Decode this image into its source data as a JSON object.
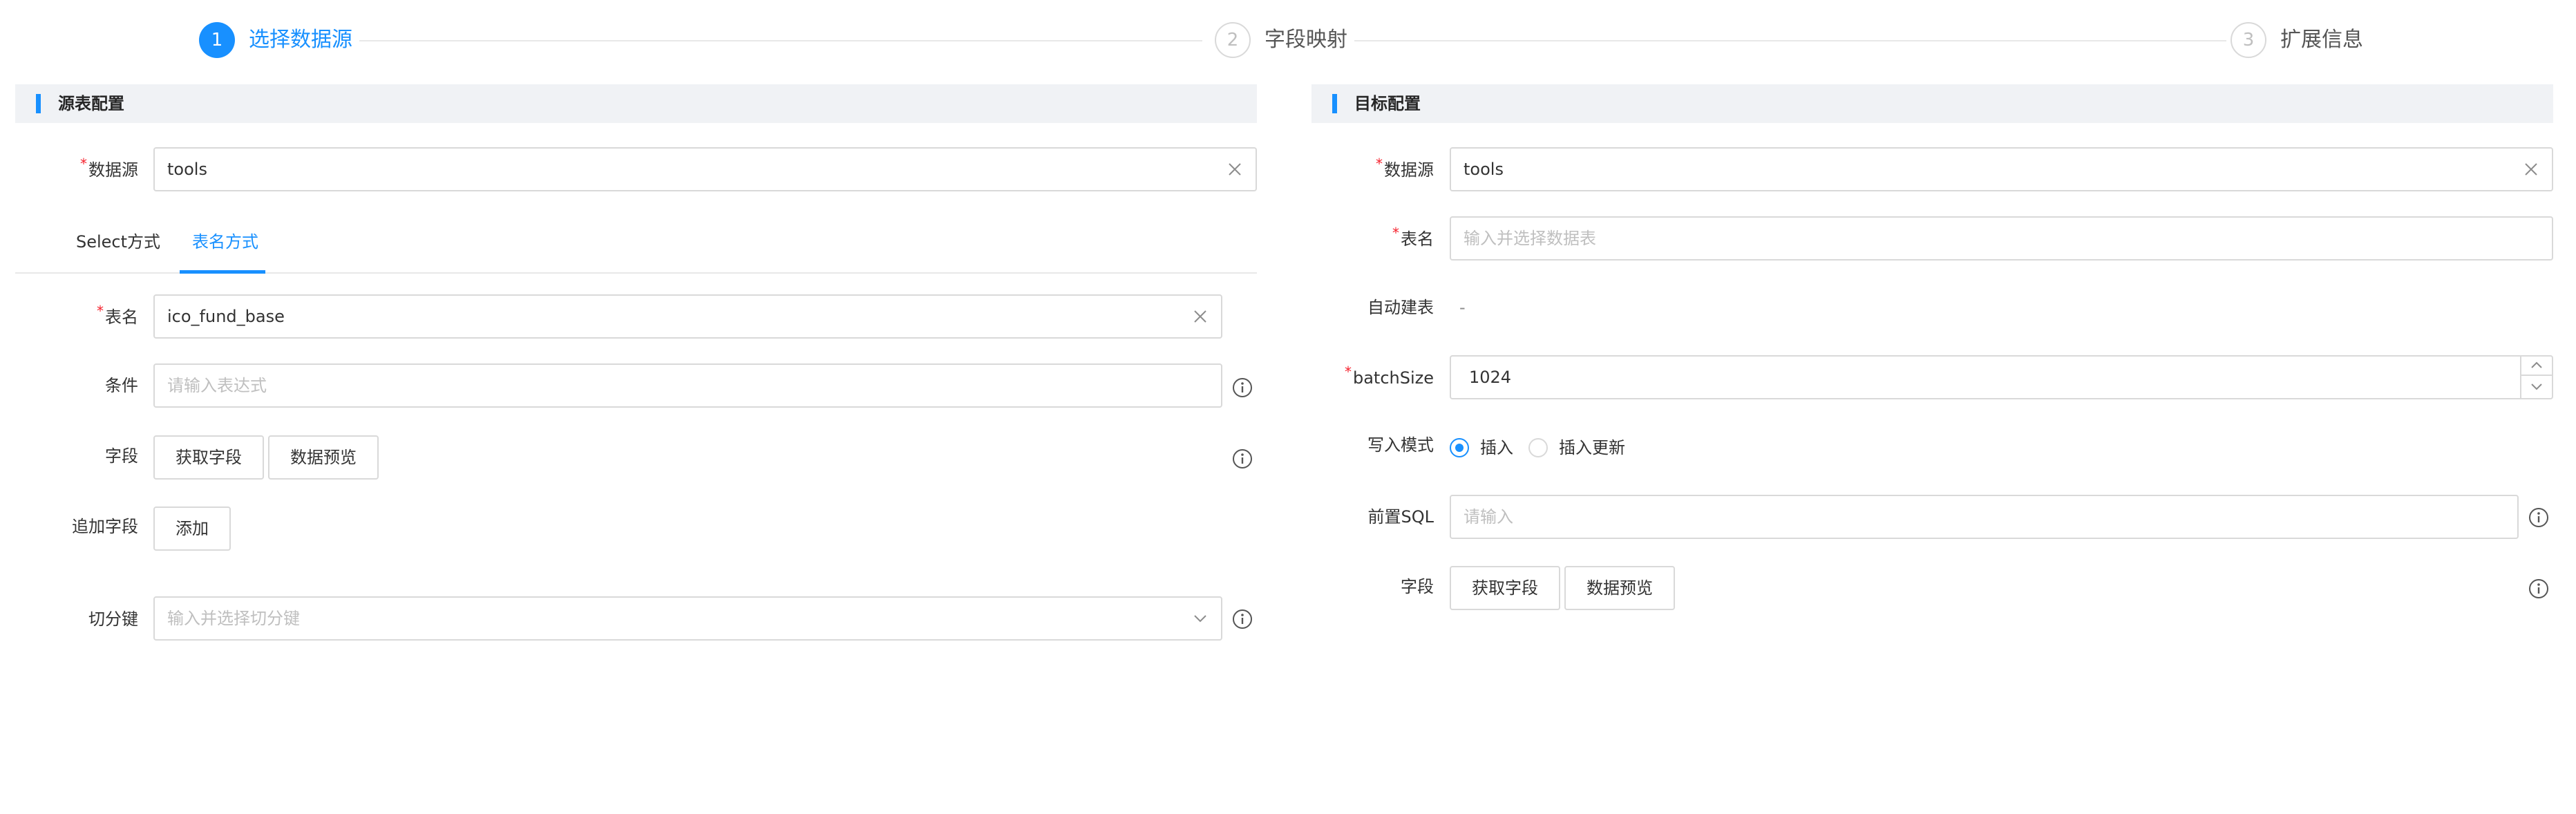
{
  "steps": [
    {
      "index": "1",
      "title": "选择数据源"
    },
    {
      "index": "2",
      "title": "字段映射"
    },
    {
      "index": "3",
      "title": "扩展信息"
    }
  ],
  "source": {
    "header": "源表配置",
    "datasource_label": "数据源",
    "datasource_value": "tools",
    "tabs": [
      "Select方式",
      "表名方式"
    ],
    "table_label": "表名",
    "table_value": "ico_fund_base",
    "condition_label": "条件",
    "condition_placeholder": "请输入表达式",
    "fields_label": "字段",
    "fetch_fields_button": "获取字段",
    "preview_button": "数据预览",
    "extra_fields_label": "追加字段",
    "add_button": "添加",
    "split_key_label": "切分键",
    "split_key_placeholder": "输入并选择切分键"
  },
  "target": {
    "header": "目标配置",
    "datasource_label": "数据源",
    "datasource_value": "tools",
    "table_label": "表名",
    "table_placeholder": "输入并选择数据表",
    "auto_create_label": "自动建表",
    "auto_create_value": "-",
    "batch_label": "batchSize",
    "batch_value": "1024",
    "write_mode_label": "写入模式",
    "write_options": [
      "插入",
      "插入更新"
    ],
    "write_selected": "插入",
    "pre_sql_label": "前置SQL",
    "pre_sql_placeholder": "请输入",
    "fields_label": "字段",
    "fetch_fields_button": "获取字段",
    "preview_button": "数据预览"
  },
  "colors": {
    "accent": "#1890ff",
    "required": "#f5222d",
    "header_bg": "#f0f2f5"
  }
}
